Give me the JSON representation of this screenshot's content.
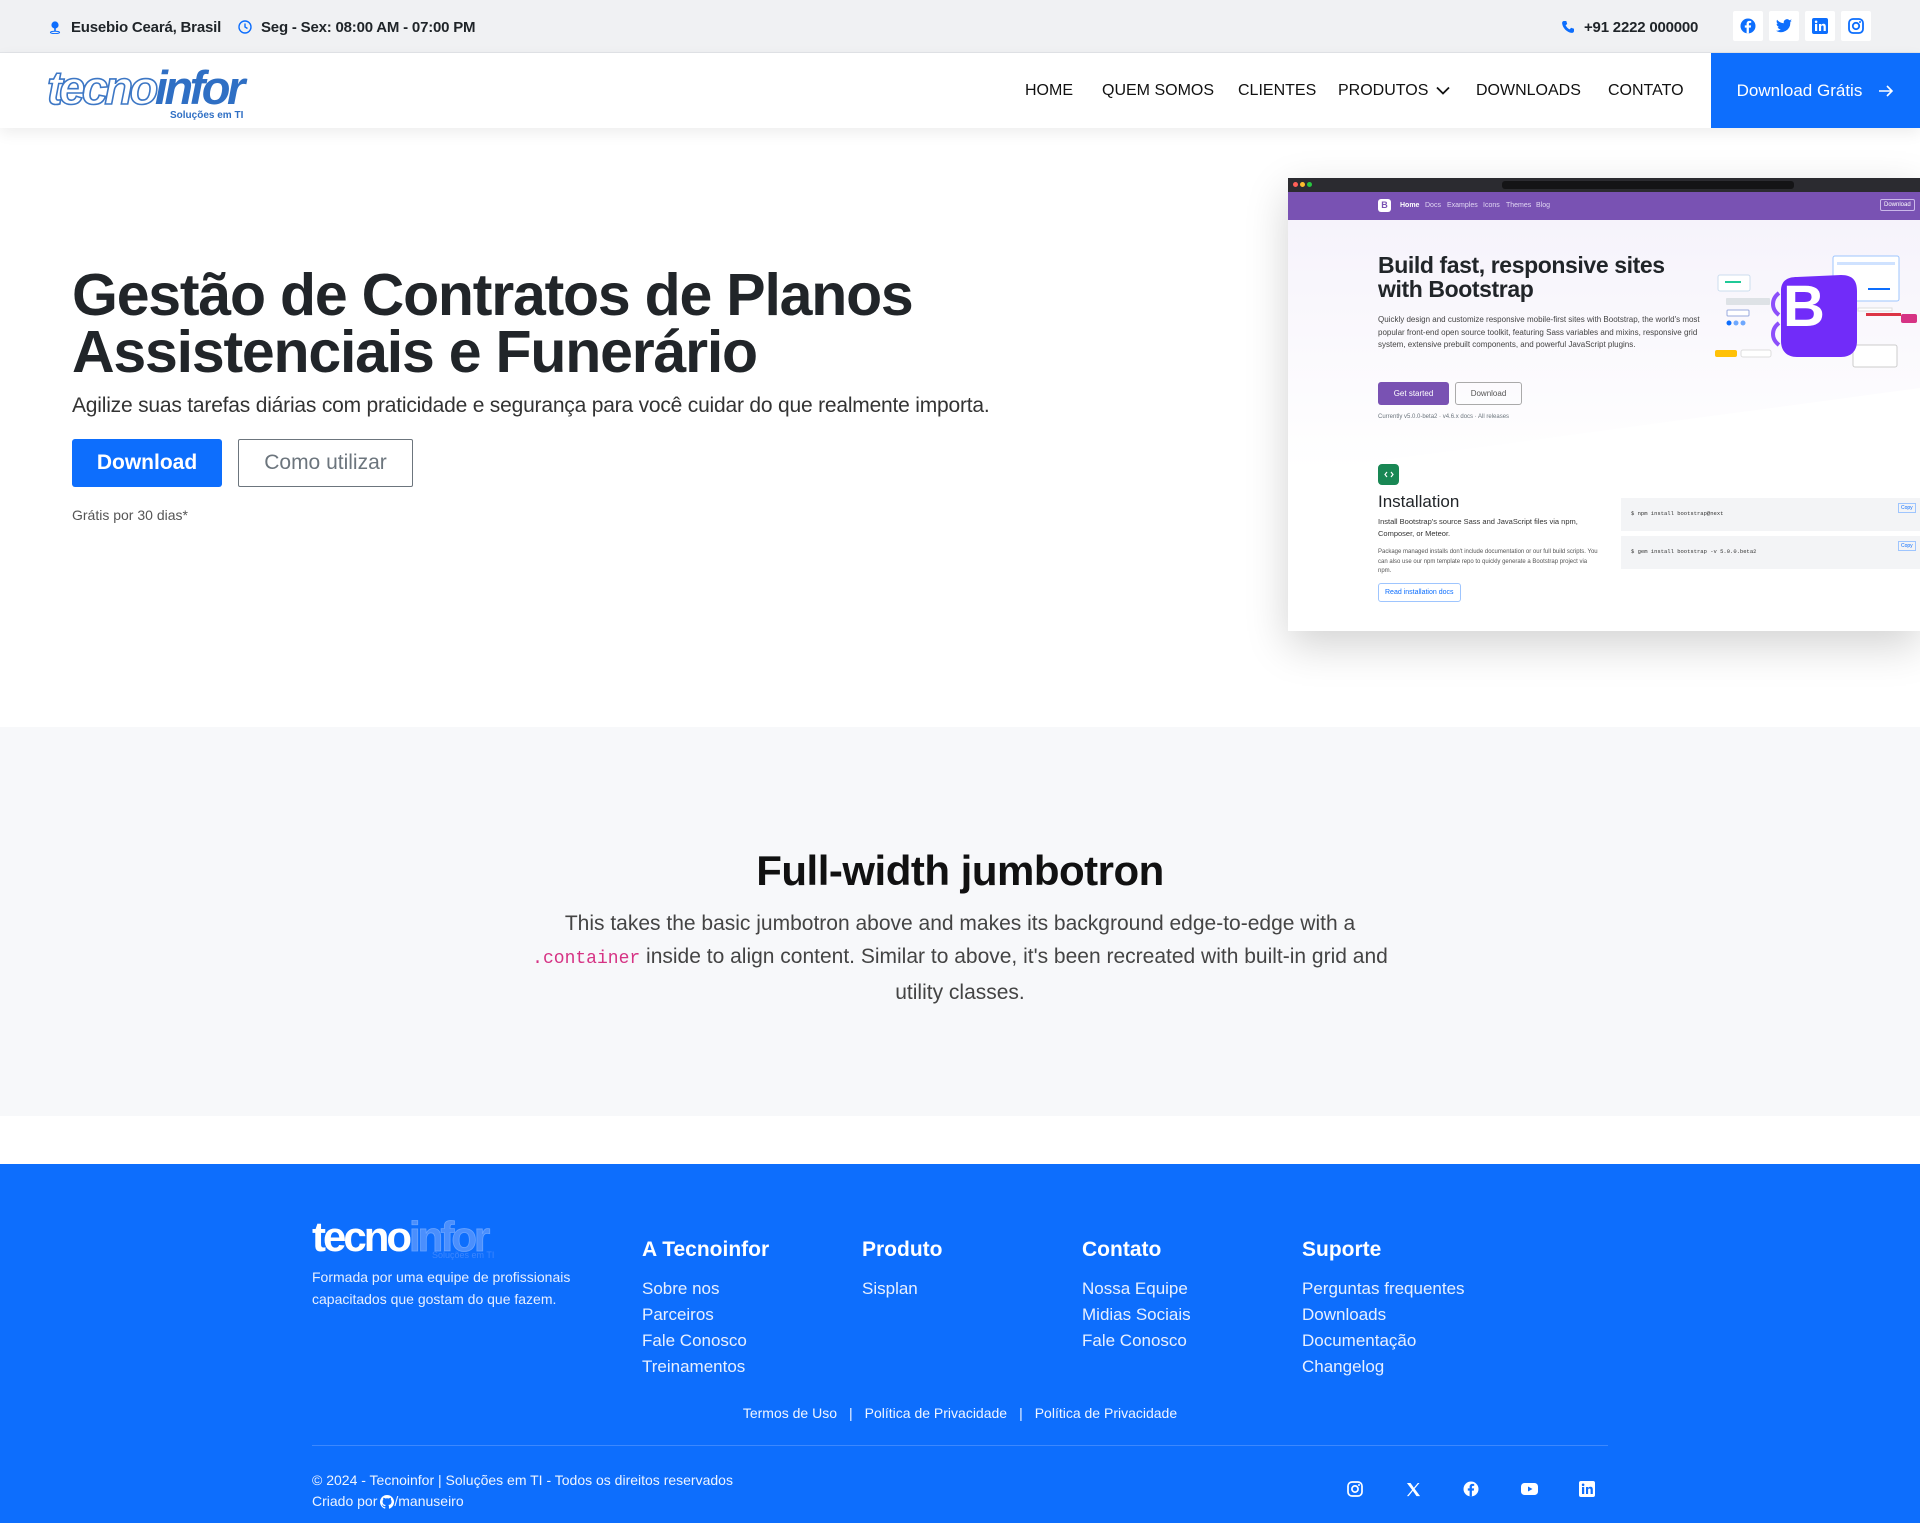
{
  "topbar": {
    "location": "Eusebio Ceará, Brasil",
    "hours": "Seg - Sex: 08:00 AM - 07:00 PM",
    "phone": "+91 2222 000000",
    "social_icons": [
      "facebook-icon",
      "twitter-icon",
      "linkedin-icon",
      "instagram-icon"
    ]
  },
  "header": {
    "logo_part1": "tecno",
    "logo_part2": "infor",
    "logo_sub": "Soluções em TI",
    "nav": [
      "HOME",
      "QUEM SOMOS",
      "CLIENTES",
      "PRODUTOS",
      "DOWNLOADS",
      "CONTATO"
    ],
    "cta_label": "Download Grátis"
  },
  "hero": {
    "title": "Gestão de Contratos de Planos Assistenciais e Funerário",
    "lead": "Agilize suas tarefas diárias com praticidade e segurança para você cuidar do que realmente importa.",
    "primary_button": "Download",
    "secondary_button": "Como utilizar",
    "note": "Grátis por 30 dias*"
  },
  "screenshot": {
    "nav_links": [
      "Home",
      "Docs",
      "Examples",
      "Icons",
      "Themes",
      "Blog"
    ],
    "nav_button": "Download",
    "headline": "Build fast, responsive sites with Bootstrap",
    "body": "Quickly design and customize responsive mobile-first sites with Bootstrap, the world's most popular front-end open source toolkit, featuring Sass variables and mixins, responsive grid system, extensive prebuilt components, and powerful JavaScript plugins.",
    "get_started": "Get started",
    "download": "Download",
    "currently": "Currently v5.0.0-beta2 · v4.6.x docs · All releases",
    "install_title": "Installation",
    "install_text": "Install Bootstrap's source Sass and JavaScript files via npm, Composer, or Meteor.",
    "install_note": "Package managed installs don't include documentation or our full build scripts. You can also use our npm template repo to quickly generate a Bootstrap project via npm.",
    "read_docs": "Read installation docs",
    "cmd1": "$ npm install bootstrap@next",
    "cmd2": "$ gem install bootstrap -v 5.0.0.beta2",
    "copy": "Copy",
    "badge_letter": "B"
  },
  "jumbotron": {
    "title": "Full-width jumbotron",
    "text_before": "This takes the basic jumbotron above and makes its background edge-to-edge with a",
    "code": ".container",
    "text_after": "inside to align content. Similar to above, it's been recreated with built-in grid and utility classes."
  },
  "footer": {
    "logo_part1": "tecno",
    "logo_part2": "infor",
    "logo_sub": "Soluções em TI",
    "description": "Formada por uma equipe de profissionais capacitados que gostam do que fazem.",
    "columns": [
      {
        "title": "A Tecnoinfor",
        "links": [
          "Sobre nos",
          "Parceiros",
          "Fale Conosco",
          "Treinamentos"
        ]
      },
      {
        "title": "Produto",
        "links": [
          "Sisplan"
        ]
      },
      {
        "title": "Contato",
        "links": [
          "Nossa Equipe",
          "Midias Sociais",
          "Fale Conosco"
        ]
      },
      {
        "title": "Suporte",
        "links": [
          "Perguntas frequentes",
          "Downloads",
          "Documentação",
          "Changelog"
        ]
      }
    ],
    "legal": [
      "Termos de Uso",
      "Política de Privacidade",
      "Política de Privacidade"
    ],
    "separator": "|",
    "copyright": "© 2024 - Tecnoinfor | Soluções em TI - Todos os direitos reservados",
    "credit_prefix": "Criado por",
    "credit_handle": "/manuseiro",
    "social_icons": [
      "instagram-icon",
      "x-icon",
      "facebook-icon",
      "youtube-icon",
      "linkedin-icon"
    ]
  },
  "colors": {
    "primary": "#0d6efd",
    "bootstrap_purple": "#7952b3",
    "code_pink": "#d63384"
  }
}
